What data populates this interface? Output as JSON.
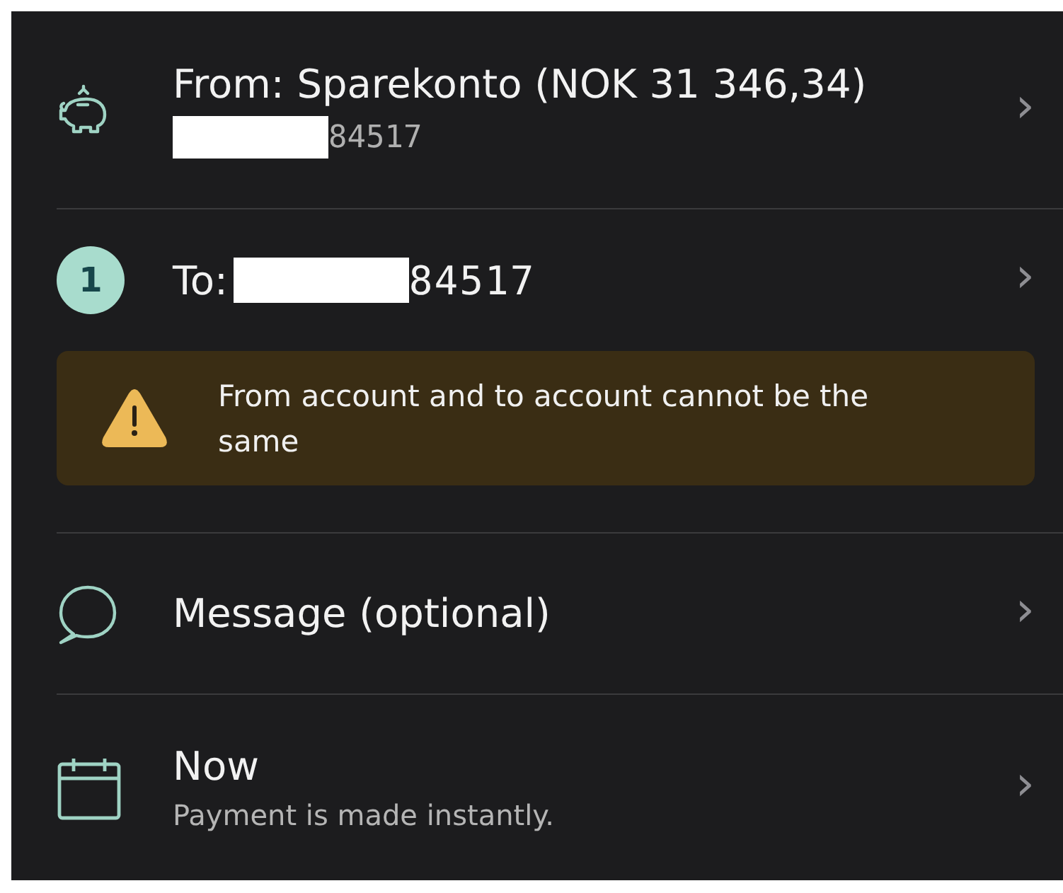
{
  "rows": [
    {
      "kind": "from",
      "title": "From: Sparekonto (NOK 31 346,34)",
      "subtitle": "84517",
      "chevron": "›"
    },
    {
      "kind": "to",
      "badge": "1",
      "title": "To:",
      "value": "84517",
      "chevron": "›",
      "warning": "From account and to account cannot be the same"
    },
    {
      "kind": "message",
      "title": "Message (optional)",
      "chevron": "›"
    },
    {
      "kind": "schedule",
      "title": "Now",
      "subtitle": "Payment is made instantly.",
      "chevron": "›"
    }
  ]
}
